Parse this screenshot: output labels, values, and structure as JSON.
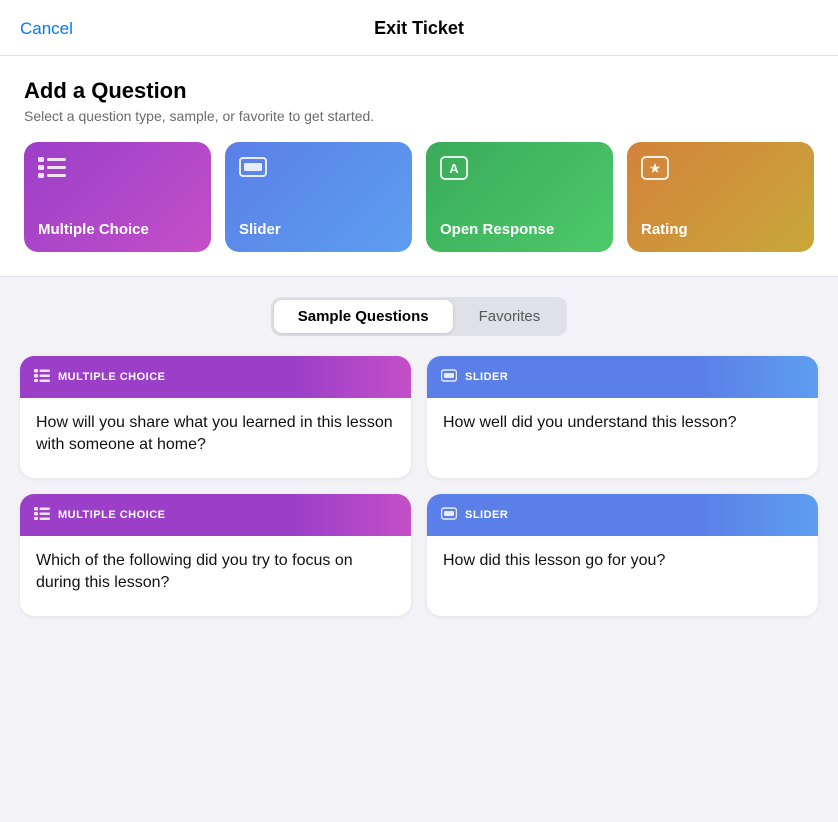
{
  "header": {
    "cancel_label": "Cancel",
    "title": "Exit Ticket"
  },
  "add_question": {
    "title": "Add a Question",
    "subtitle": "Select a question type, sample, or favorite to get started.",
    "type_cards": [
      {
        "id": "mc",
        "label": "Multiple Choice",
        "icon": "≡",
        "color_class": "type-card-mc"
      },
      {
        "id": "slider",
        "label": "Slider",
        "icon": "▭",
        "color_class": "type-card-slider"
      },
      {
        "id": "open",
        "label": "Open Response",
        "icon": "A",
        "color_class": "type-card-open"
      },
      {
        "id": "rating",
        "label": "Rating",
        "icon": "★",
        "color_class": "type-card-rating"
      }
    ]
  },
  "tabs": [
    {
      "id": "sample",
      "label": "Sample Questions",
      "active": true
    },
    {
      "id": "favorites",
      "label": "Favorites",
      "active": false
    }
  ],
  "questions": [
    {
      "id": "q1",
      "type": "MULTIPLE CHOICE",
      "type_id": "mc",
      "header_class": "qch-mc",
      "text": "How will you share what you learned in this lesson with someone at home?"
    },
    {
      "id": "q2",
      "type": "SLIDER",
      "type_id": "slider",
      "header_class": "qch-slider",
      "text": "How well did you understand this lesson?"
    },
    {
      "id": "q3",
      "type": "MULTIPLE CHOICE",
      "type_id": "mc",
      "header_class": "qch-mc",
      "text": "Which of the following did you try to focus on during this lesson?"
    },
    {
      "id": "q4",
      "type": "SLIDER",
      "type_id": "slider",
      "header_class": "qch-slider",
      "text": "How did this lesson go for you?"
    }
  ],
  "icons": {
    "multiple_choice": "☰",
    "slider": "▭",
    "open_response": "Ⓐ",
    "rating": "★",
    "mc_card": "☰",
    "slider_card": "▭"
  }
}
